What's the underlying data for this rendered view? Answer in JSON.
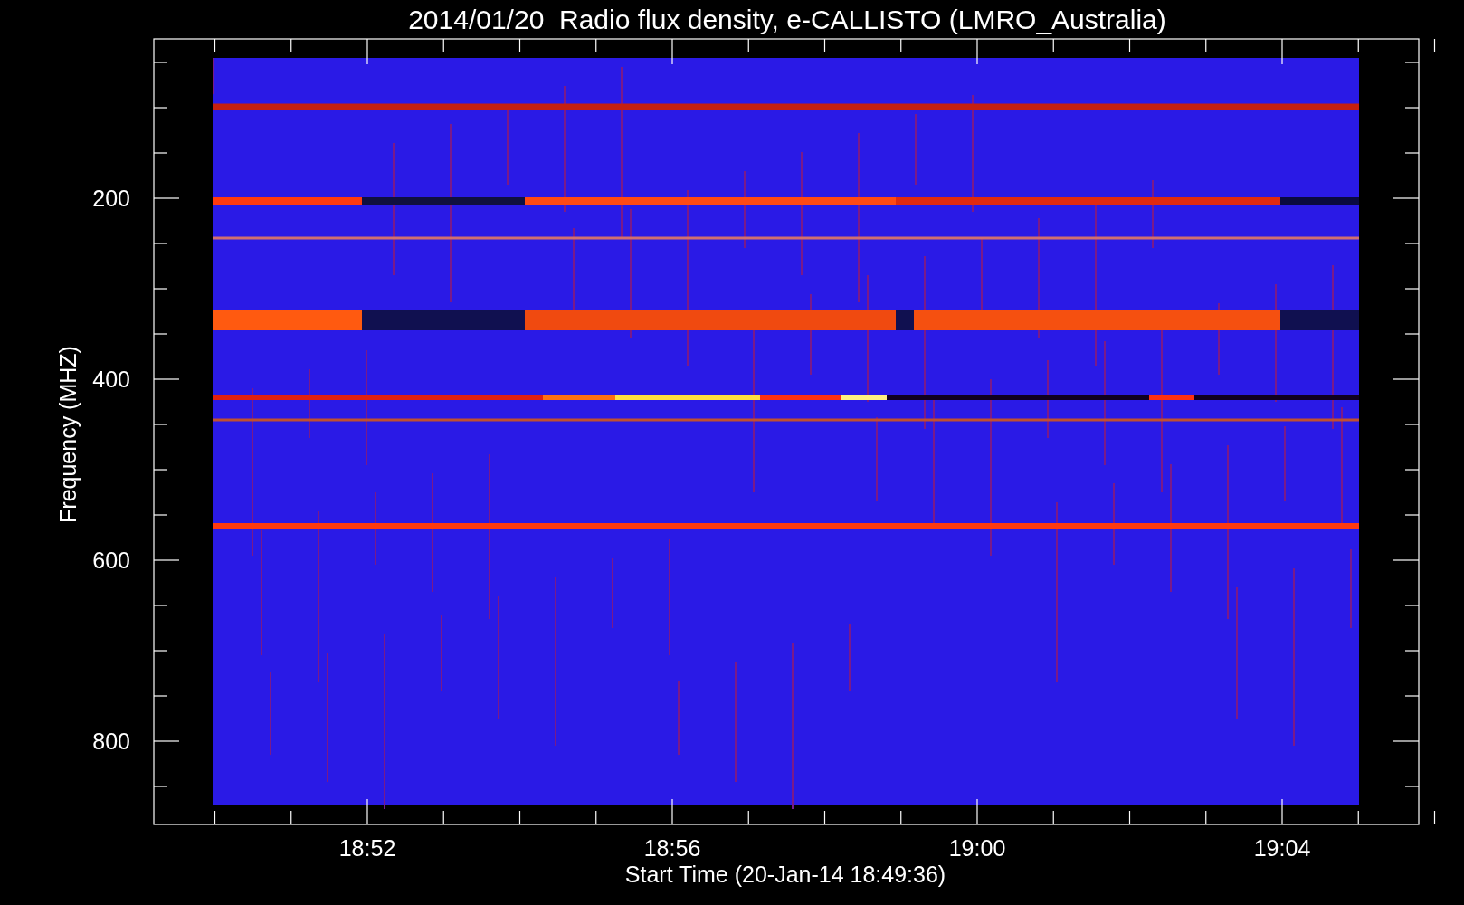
{
  "title": "2014/01/20  Radio flux density, e-CALLISTO (LMRO_Australia)",
  "y_axis": {
    "label": "Frequency (MHZ)",
    "ticks": [
      "200",
      "400",
      "600",
      "800"
    ]
  },
  "x_axis": {
    "label": "Start Time (20-Jan-14 18:49:36)",
    "ticks": [
      "18:52",
      "18:56",
      "19:00",
      "19:04"
    ]
  }
}
